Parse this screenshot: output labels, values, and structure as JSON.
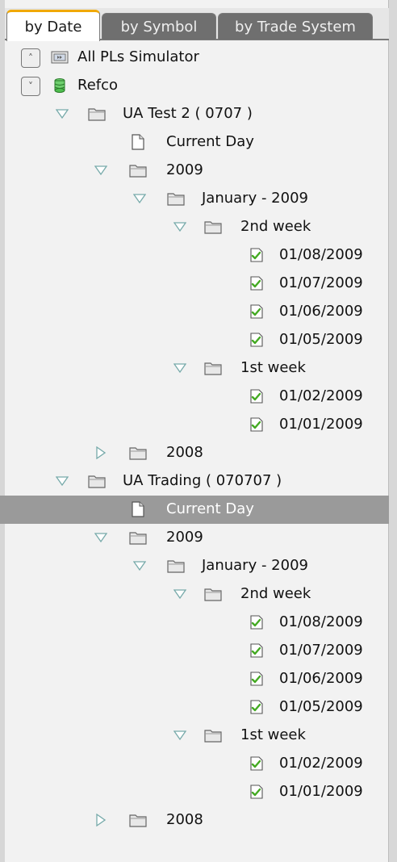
{
  "tabs": [
    {
      "label": "by Date",
      "active": true
    },
    {
      "label": "by Symbol",
      "active": false
    },
    {
      "label": "by Trade System",
      "active": false
    }
  ],
  "tree": [
    {
      "label": "All PLs Simulator",
      "icon": "simulator-icon",
      "indent": 0,
      "control": "collapse-all",
      "twisty": null
    },
    {
      "label": "Refco",
      "icon": "database-icon",
      "indent": 0,
      "control": "expand-all",
      "twisty": null
    },
    {
      "label": "UA Test 2 ( 0707 )",
      "icon": "folder-icon",
      "indent": 1,
      "twisty": "expanded"
    },
    {
      "label": "Current Day",
      "icon": "page-icon",
      "indent": 2,
      "twisty": null
    },
    {
      "label": "2009",
      "icon": "folder-icon",
      "indent": 2,
      "twisty": "expanded"
    },
    {
      "label": "January - 2009",
      "icon": "folder-icon",
      "indent": 3,
      "twisty": "expanded"
    },
    {
      "label": "2nd week",
      "icon": "folder-icon",
      "indent": 4,
      "twisty": "expanded"
    },
    {
      "label": "01/08/2009",
      "icon": "check-document-icon",
      "indent": 5,
      "twisty": null
    },
    {
      "label": "01/07/2009",
      "icon": "check-document-icon",
      "indent": 5,
      "twisty": null
    },
    {
      "label": "01/06/2009",
      "icon": "check-document-icon",
      "indent": 5,
      "twisty": null
    },
    {
      "label": "01/05/2009",
      "icon": "check-document-icon",
      "indent": 5,
      "twisty": null
    },
    {
      "label": "1st week",
      "icon": "folder-icon",
      "indent": 4,
      "twisty": "expanded"
    },
    {
      "label": "01/02/2009",
      "icon": "check-document-icon",
      "indent": 5,
      "twisty": null
    },
    {
      "label": "01/01/2009",
      "icon": "check-document-icon",
      "indent": 5,
      "twisty": null
    },
    {
      "label": "2008",
      "icon": "folder-icon",
      "indent": 2,
      "twisty": "collapsed"
    },
    {
      "label": "UA Trading ( 070707 )",
      "icon": "folder-icon",
      "indent": 1,
      "twisty": "expanded"
    },
    {
      "label": "Current Day",
      "icon": "page-icon",
      "indent": 2,
      "twisty": null,
      "selected": true
    },
    {
      "label": "2009",
      "icon": "folder-icon",
      "indent": 2,
      "twisty": "expanded"
    },
    {
      "label": "January - 2009",
      "icon": "folder-icon",
      "indent": 3,
      "twisty": "expanded"
    },
    {
      "label": "2nd week",
      "icon": "folder-icon",
      "indent": 4,
      "twisty": "expanded"
    },
    {
      "label": "01/08/2009",
      "icon": "check-document-icon",
      "indent": 5,
      "twisty": null
    },
    {
      "label": "01/07/2009",
      "icon": "check-document-icon",
      "indent": 5,
      "twisty": null
    },
    {
      "label": "01/06/2009",
      "icon": "check-document-icon",
      "indent": 5,
      "twisty": null
    },
    {
      "label": "01/05/2009",
      "icon": "check-document-icon",
      "indent": 5,
      "twisty": null
    },
    {
      "label": "1st week",
      "icon": "folder-icon",
      "indent": 4,
      "twisty": "expanded"
    },
    {
      "label": "01/02/2009",
      "icon": "check-document-icon",
      "indent": 5,
      "twisty": null
    },
    {
      "label": "01/01/2009",
      "icon": "check-document-icon",
      "indent": 5,
      "twisty": null
    },
    {
      "label": "2008",
      "icon": "folder-icon",
      "indent": 2,
      "twisty": "collapsed"
    }
  ],
  "colors": {
    "selected_row": "#9a9a9a",
    "active_tab_accent": "#f0a800",
    "check_green": "#44aa22"
  }
}
